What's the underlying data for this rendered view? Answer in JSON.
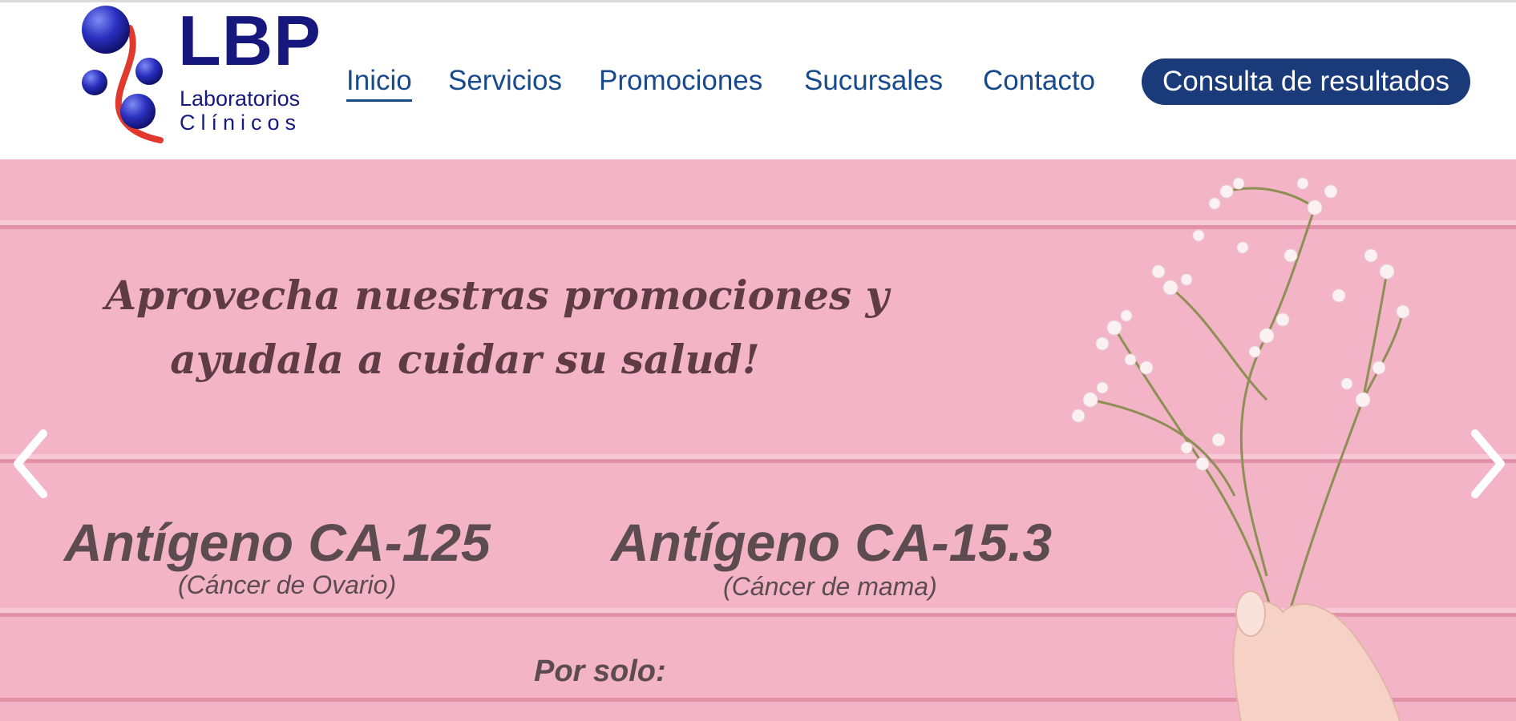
{
  "header": {
    "logo": {
      "title": "LBP",
      "subtitle_line1": "Laboratorios",
      "subtitle_line2": "Clínicos"
    },
    "nav": [
      {
        "label": "Inicio",
        "active": true
      },
      {
        "label": "Servicios",
        "active": false
      },
      {
        "label": "Promociones",
        "active": false
      },
      {
        "label": "Sucursales",
        "active": false
      },
      {
        "label": "Contacto",
        "active": false
      }
    ],
    "results_button": "Consulta de resultados"
  },
  "slider": {
    "headline_line1": "Aprovecha nuestras promociones y",
    "headline_line2": "ayudala a cuidar su salud!",
    "tests": [
      {
        "name": "Antígeno CA-125",
        "note": "(Cáncer de Ovario)"
      },
      {
        "name": "Antígeno CA-15.3",
        "note": "(Cáncer de mama)"
      }
    ],
    "price_label": "Por solo:",
    "prev_icon": "chevron-left-icon",
    "next_icon": "chevron-right-icon"
  },
  "colors": {
    "brand_navy": "#16187e",
    "nav_blue": "#184a8c",
    "button_bg": "#1b3a7a",
    "hero_pink": "#f2b4c6",
    "promo_text": "#5d4b52"
  }
}
